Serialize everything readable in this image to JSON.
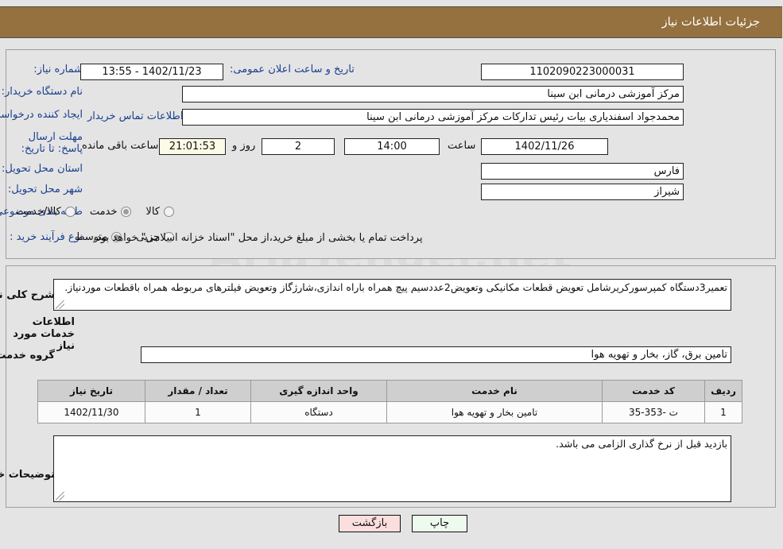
{
  "header": {
    "title": "جزئیات اطلاعات نیاز"
  },
  "watermark": {
    "text": "AriaTender.net"
  },
  "top": {
    "need_number_label": "شماره نیاز:",
    "need_number_value": "1102090223000031",
    "announce_label": "تاریخ و ساعت اعلان عمومی:",
    "announce_value": "1402/11/23 - 13:55",
    "buyer_org_label": "نام دستگاه خریدار:",
    "buyer_org_value": "مرکز آموزشی درمانی ابن سینا",
    "creator_label": "ایجاد کننده درخواست:",
    "creator_value": "محمدجواد  اسفندیاری بیات رئیس تدارکات مرکز آموزشی درمانی ابن سینا",
    "contact_link": "اطلاعات تماس خریدار",
    "deadline_label": "مهلت ارسال پاسخ: تا تاریخ:",
    "deadline_date": "1402/11/26",
    "hour_label": "ساعت",
    "deadline_time": "14:00",
    "days_value": "2",
    "days_label": "روز و",
    "timer_value": "21:01:53",
    "timer_label": "ساعت باقی مانده",
    "province_label": "استان محل تحویل:",
    "province_value": "فارس",
    "city_label": "شهر محل تحویل:",
    "city_value": "شیراز",
    "category_label": "طبقه بندی موضوعی:",
    "category_options": [
      {
        "label": "کالا",
        "selected": false
      },
      {
        "label": "خدمت",
        "selected": true
      },
      {
        "label": "کالا/خدمت",
        "selected": false
      }
    ],
    "process_label": "نوع فرآیند خرید :",
    "process_options": [
      {
        "label": "جزیی",
        "selected": false
      },
      {
        "label": "متوسط",
        "selected": true
      }
    ],
    "payment_note": "پرداخت تمام یا بخشی از مبلغ خرید،از محل \"اسناد خزانه اسلامی\" خواهد بود."
  },
  "bottom": {
    "need_desc_label": "شرح کلی نیاز:",
    "need_desc_value": "تعمیر3دستگاه کمپرسورکریرشامل تعویض قطعات مکانیکی وتعویض2عددسیم پیچ همراه باراه اندازی،شارژگاز وتعویض فیلترهای مربوطه همراه باقطعات موردنیاز.",
    "services_heading": "اطلاعات خدمات مورد نیاز",
    "service_group_label": "گروه خدمت:",
    "service_group_value": "تامین برق، گاز، بخار و تهویه هوا",
    "table": {
      "columns": [
        "ردیف",
        "کد خدمت",
        "نام خدمت",
        "واحد اندازه گیری",
        "تعداد / مقدار",
        "تاریخ نیاز"
      ],
      "rows": [
        [
          "1",
          "ت -353-35",
          "تامین بخار و تهویه هوا",
          "دستگاه",
          "1",
          "1402/11/30"
        ]
      ]
    },
    "buyer_notes_label": "توضیحات خریدار:",
    "buyer_notes_value": "بازدید قبل از نرخ گذاری الزامی می باشد."
  },
  "footer": {
    "print_label": "چاپ",
    "back_label": "بازگشت"
  }
}
